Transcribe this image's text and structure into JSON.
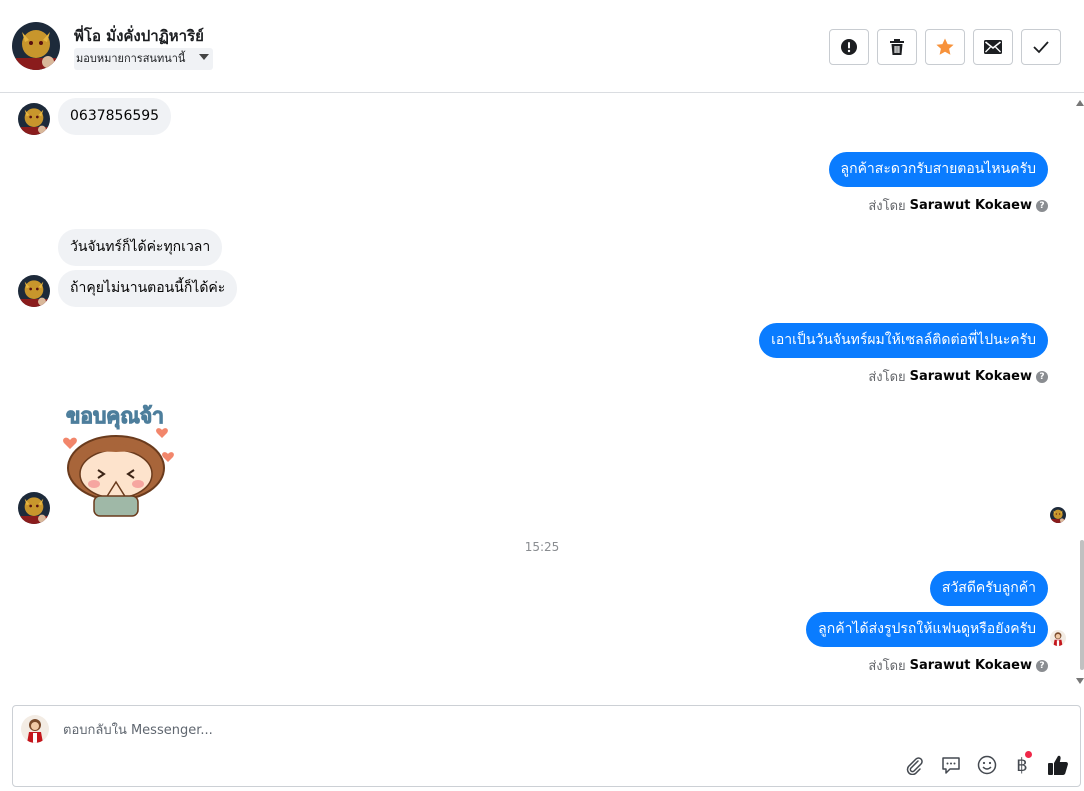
{
  "header": {
    "contact_name": "พี่โอ มั่งคั่งปาฏิหาริย์",
    "assign_label": "มอบหมายการสนทนานี้",
    "actions": [
      {
        "name": "report-button",
        "icon": "exclamation-circle-icon"
      },
      {
        "name": "delete-button",
        "icon": "trash-icon"
      },
      {
        "name": "star-button",
        "icon": "star-icon"
      },
      {
        "name": "mark-unread-button",
        "icon": "envelope-icon"
      },
      {
        "name": "mark-done-button",
        "icon": "checkmark-icon"
      }
    ],
    "star_color": "#f7923b"
  },
  "messages": {
    "in_1": "0637856595",
    "out_1": "ลูกค้าสะดวกรับสายตอนไหนครับ",
    "in_2": "วันจันทร์ก็ได้ค่ะทุกเวลา",
    "in_3": "ถ้าคุยไม่นานตอนนี้ก็ได้ค่ะ",
    "out_2": "เอาเป็นวันจันทร์ผมให้เซลล์ติดต่อพี่ไปนะครับ",
    "sticker_text": "ขอบคุณจ้า",
    "timestamp": "15:25",
    "out_3": "สวัสดีครับลูกค้า",
    "out_4": "ลูกค้าได้ส่งรูปรถให้แฟนดูหรือยังครับ"
  },
  "sent_by": {
    "prefix": "ส่งโดย",
    "agent_name": "Sarawut Kokaew",
    "help_glyph": "?"
  },
  "composer": {
    "placeholder": "ตอบกลับใน Messenger...",
    "icons": [
      "paperclip-icon",
      "saved-reply-icon",
      "emoji-icon",
      "baht-payment-icon",
      "thumbs-up-icon"
    ],
    "baht_glyph": "฿"
  },
  "colors": {
    "outgoing_bubble": "#0a7cff",
    "incoming_bubble": "#f0f2f5",
    "notification_dot": "#f02849"
  }
}
